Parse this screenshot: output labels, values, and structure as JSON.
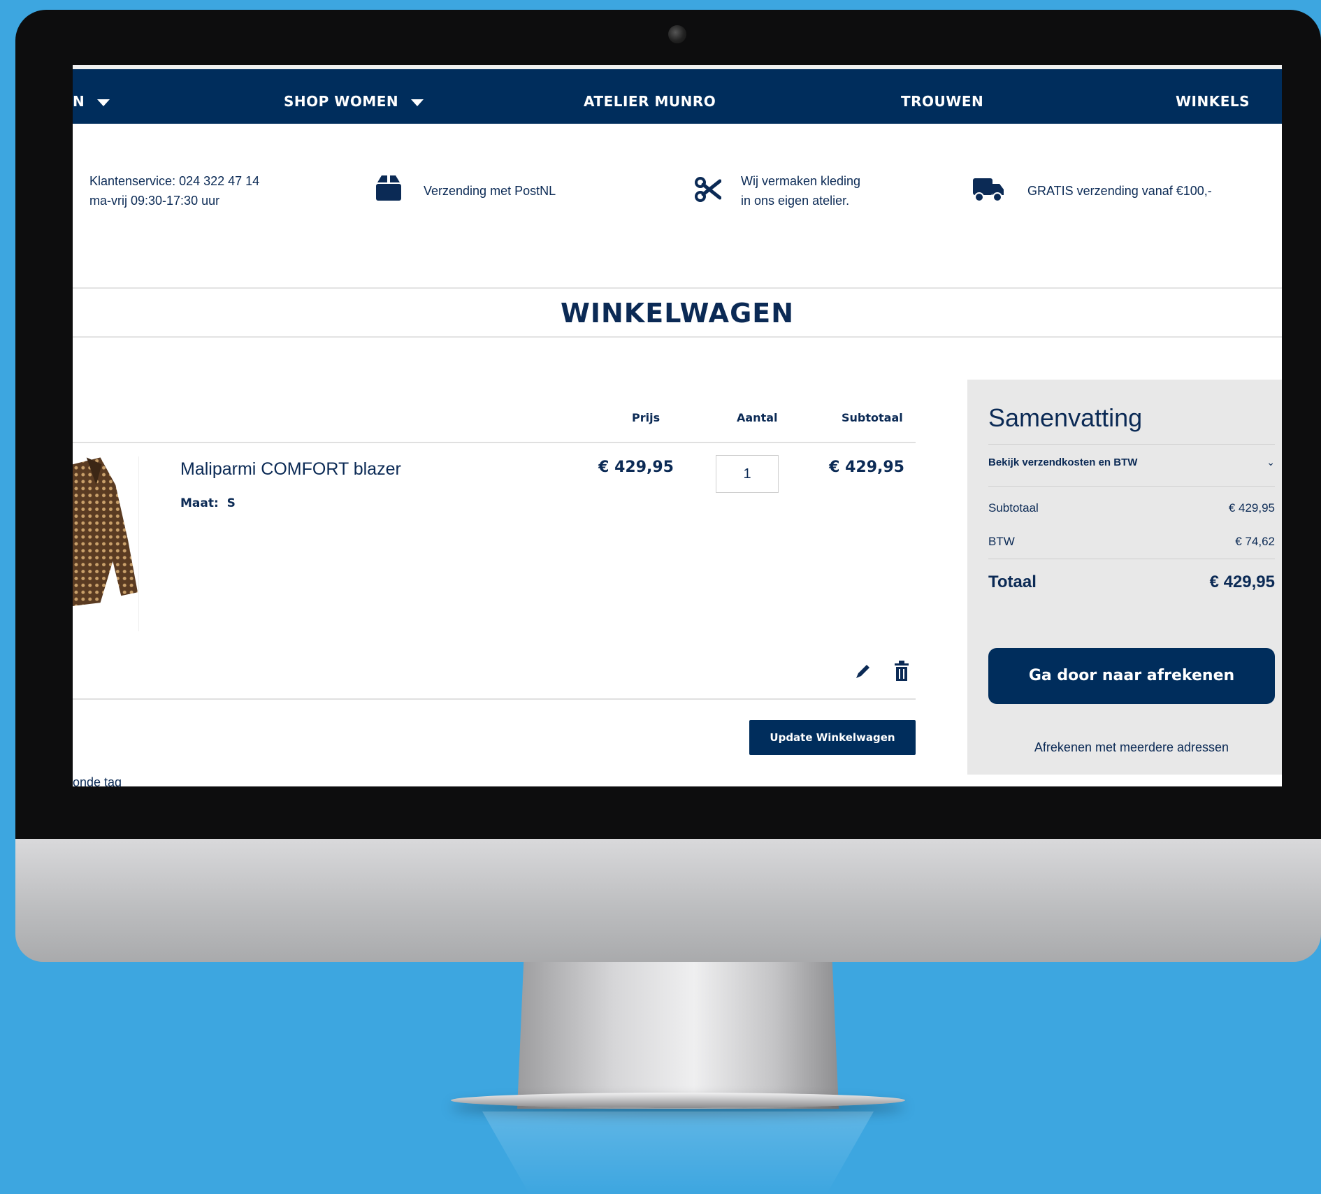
{
  "nav": {
    "items": [
      {
        "label": "N"
      },
      {
        "label": "SHOP WOMEN"
      },
      {
        "label": "ATELIER MUNRO"
      },
      {
        "label": "TROUWEN"
      },
      {
        "label": "WINKELS"
      }
    ]
  },
  "usps": {
    "service_line1": "Klantenservice: 024 322 47 14",
    "service_line2": "ma-vrij 09:30-17:30 uur",
    "shipping": "Verzending met PostNL",
    "atelier_line1": "Wij vermaken kleding",
    "atelier_line2": "in ons eigen atelier.",
    "free_shipping": "GRATIS verzending vanaf €100,-",
    "icons": [
      "box-icon",
      "scissors-icon",
      "truck-icon"
    ]
  },
  "page": {
    "title": "WINKELWAGEN"
  },
  "cart": {
    "columns": {
      "price": "Prijs",
      "qty": "Aantal",
      "subtotal": "Subtotaal"
    },
    "item": {
      "name": "Maliparmi COMFORT blazer",
      "size_label": "Maat:",
      "size_value": "S",
      "price": "€ 429,95",
      "qty": "1",
      "subtotal": "€ 429,95"
    },
    "update_button": "Update Winkelwagen",
    "cutoff_text": "onde tag"
  },
  "summary": {
    "title": "Samenvatting",
    "shipping_toggle": "Bekijk verzendkosten en BTW",
    "subtotal_label": "Subtotaal",
    "subtotal_value": "€ 429,95",
    "vat_label": "BTW",
    "vat_value": "€ 74,62",
    "total_label": "Totaal",
    "total_value": "€ 429,95",
    "checkout_button": "Ga door naar afrekenen",
    "multi_address_link": "Afrekenen met meerdere adressen"
  },
  "colors": {
    "brand_navy": "#002d5c",
    "background": "#3da6e0",
    "summary_bg": "#e8e8e8"
  }
}
